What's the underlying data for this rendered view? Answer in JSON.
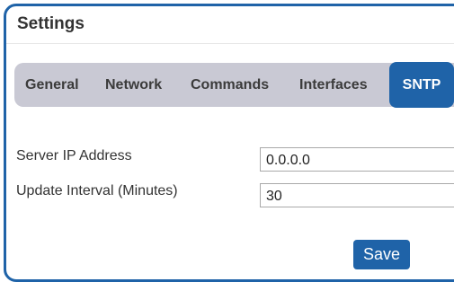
{
  "panel": {
    "title": "Settings"
  },
  "tabs": [
    {
      "label": "General",
      "active": false
    },
    {
      "label": "Network",
      "active": false
    },
    {
      "label": "Commands",
      "active": false
    },
    {
      "label": "Interfaces",
      "active": false
    },
    {
      "label": "SNTP",
      "active": true
    }
  ],
  "form": {
    "server_ip": {
      "label": "Server IP Address",
      "value": "0.0.0.0"
    },
    "update_interval": {
      "label": "Update Interval (Minutes)",
      "value": "30"
    }
  },
  "actions": {
    "save_label": "Save"
  },
  "colors": {
    "accent": "#1f63a8",
    "tabbar_bg": "#c9c9d4",
    "text": "#333333"
  }
}
